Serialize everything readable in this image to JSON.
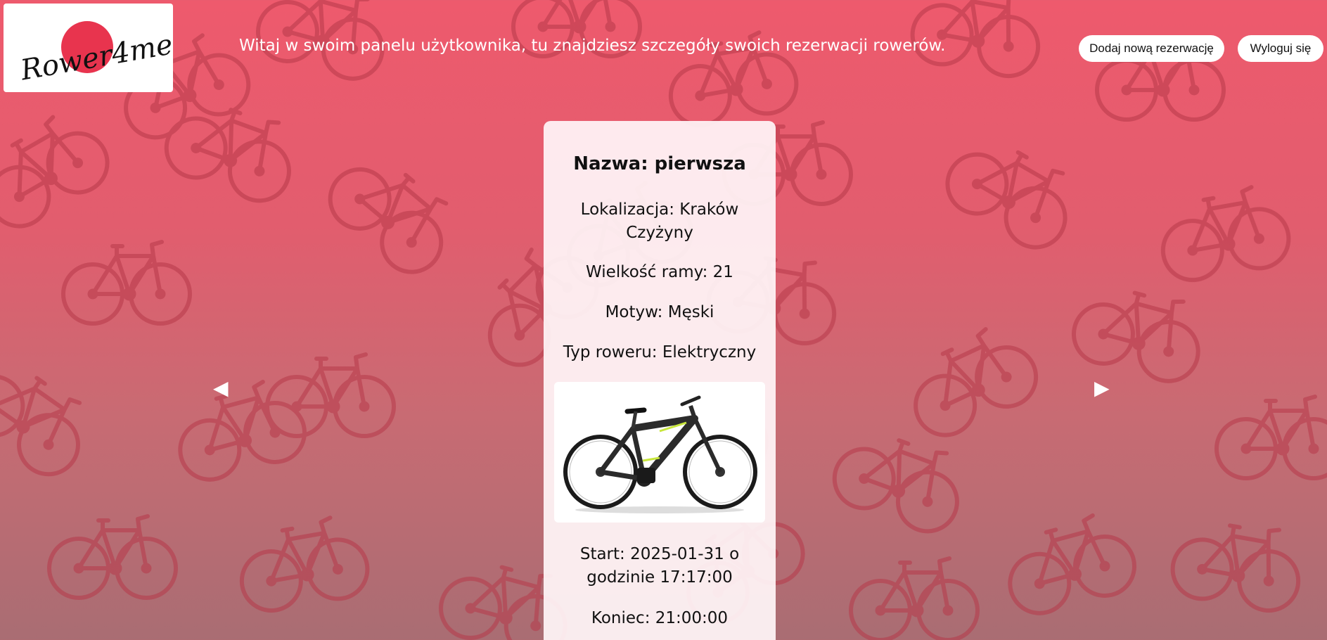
{
  "logo": {
    "text": "Rower4me",
    "accent": "#e8344e"
  },
  "header": {
    "welcome": "Witaj w swoim panelu użytkownika, tu znajdziesz szczegóły swoich rezerwacji rowerów.",
    "add_button": "Dodaj nową rezerwację",
    "logout_button": "Wyloguj się"
  },
  "navigation": {
    "prev_icon": "◀",
    "next_icon": "▶"
  },
  "reservation": {
    "name": "Nazwa: pierwsza",
    "location": "Lokalizacja: Kraków Czyżyny",
    "frame_size": "Wielkość ramy: 21",
    "motif": "Motyw: Męski",
    "bike_type": "Typ roweru: Elektryczny",
    "bike_image_icon": "electric-bike-image",
    "start": "Start: 2025-01-31 o godzinie 17:17:00",
    "end": "Koniec: 21:00:00"
  },
  "colors": {
    "background_top": "#ee5a6d",
    "background_bottom": "#a96d73",
    "pattern": "#b63a4a",
    "bike_accent": "#c8e63c"
  }
}
